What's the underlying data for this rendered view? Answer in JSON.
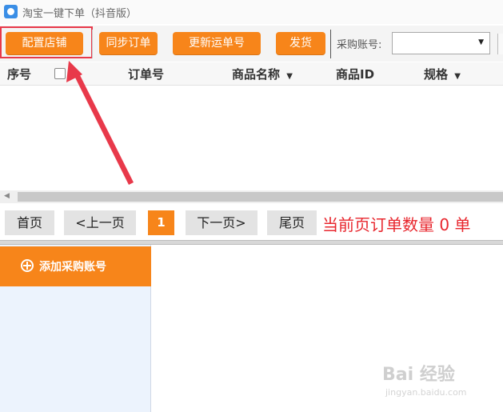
{
  "window": {
    "title": "淘宝一键下单（抖音版）"
  },
  "toolbar": {
    "config_shop": "配置店铺",
    "sync_orders": "同步订单",
    "update_tracking": "更新运单号",
    "ship": "发货",
    "account_label": "采购账号:",
    "account_value": ""
  },
  "table": {
    "headers": {
      "seq": "序号",
      "order_no": "订单号",
      "product_name": "商品名称",
      "product_id": "商品ID",
      "spec": "规格"
    }
  },
  "pager": {
    "first": "首页",
    "prev": "<上一页",
    "current": "1",
    "next": "下一页>",
    "last": "尾页",
    "count_text": "当前页订单数量 0 单"
  },
  "side": {
    "add_account": "添加采购账号"
  },
  "watermark": {
    "brand": "Bai 经验",
    "url": "jingyan.baidu.com"
  },
  "colors": {
    "accent": "#f7851a",
    "highlight": "#e8394a",
    "count_red": "#e8262d"
  }
}
